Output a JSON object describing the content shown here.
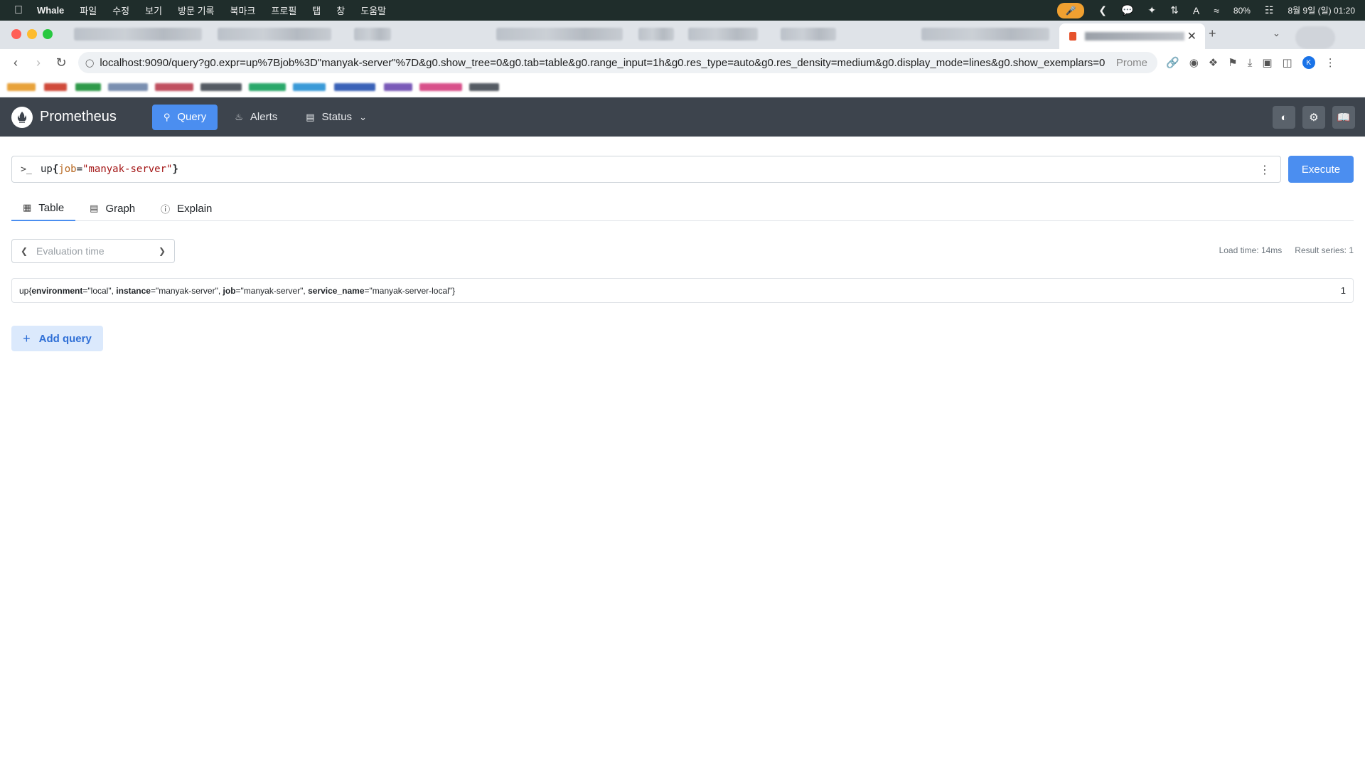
{
  "menubar": {
    "app_name": "Whale",
    "items": [
      "파일",
      "수정",
      "보기",
      "방문 기록",
      "북마크",
      "프로필",
      "탭",
      "창",
      "도움말"
    ],
    "battery": "80%",
    "clock": "8월 9일 (일) 01:20",
    "input_indicator": "A"
  },
  "browser": {
    "url": "localhost:9090/query?g0.expr=up%7Bjob%3D\"manyak-server\"%7D&g0.show_tree=0&g0.tab=table&g0.range_input=1h&g0.res_type=auto&g0.res_density=medium&g0.display_mode=lines&g0.show_exemplars=0",
    "url_suffix": "Prome",
    "profile_initial": "K"
  },
  "navbar": {
    "brand": "Prometheus",
    "links": {
      "query": "Query",
      "alerts": "Alerts",
      "status": "Status"
    }
  },
  "query": {
    "prompt": ">_",
    "expr": {
      "metric": "up",
      "open": "{",
      "label_key": "job",
      "eq": "=",
      "label_value": "\"manyak-server\"",
      "close": "}"
    },
    "execute_label": "Execute"
  },
  "tabs": {
    "table": "Table",
    "graph": "Graph",
    "explain": "Explain"
  },
  "eval": {
    "placeholder": "Evaluation time"
  },
  "stats": {
    "load_time": "Load time: 14ms",
    "result_series": "Result series: 1"
  },
  "result": {
    "metric": "up",
    "labels": [
      {
        "key": "environment",
        "value": "\"local\""
      },
      {
        "key": "instance",
        "value": "\"manyak-server\""
      },
      {
        "key": "job",
        "value": "\"manyak-server\""
      },
      {
        "key": "service_name",
        "value": "\"manyak-server-local\""
      }
    ],
    "value": "1"
  },
  "add_query_label": "Add query",
  "colors": {
    "accent": "#4b8ef0",
    "navbar": "#3d444d",
    "menubar": "#1f2d2b"
  }
}
